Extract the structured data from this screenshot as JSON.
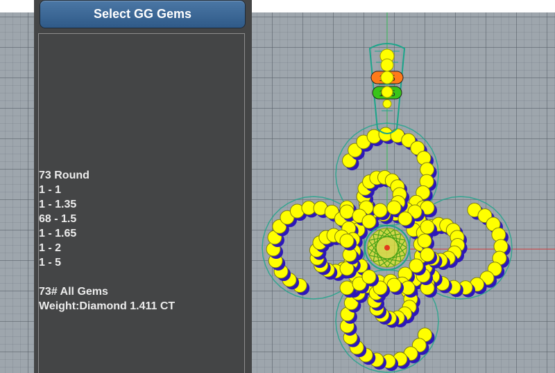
{
  "button": {
    "label": "Select GG Gems"
  },
  "summary": {
    "round_count": "73 Round",
    "sizes": [
      "1 - 1",
      "1 - 1.35",
      "68 - 1.5",
      "1 - 1.65",
      "1 - 2",
      "1 - 5"
    ],
    "total": "73# All Gems",
    "weight": "Weight:Diamond 1.411 CT"
  },
  "markers": {
    "orange": "1.35",
    "green": "1.65"
  },
  "colors": {
    "panel": "#444546",
    "button": "#3a6694",
    "gem_fill": "#ffff00",
    "gem_shadow": "#2d17b8",
    "wire": "#1aa58a",
    "marker_orange": "#ff7a1a",
    "marker_green": "#39c41a"
  },
  "icons": [
    "gem-icon"
  ]
}
